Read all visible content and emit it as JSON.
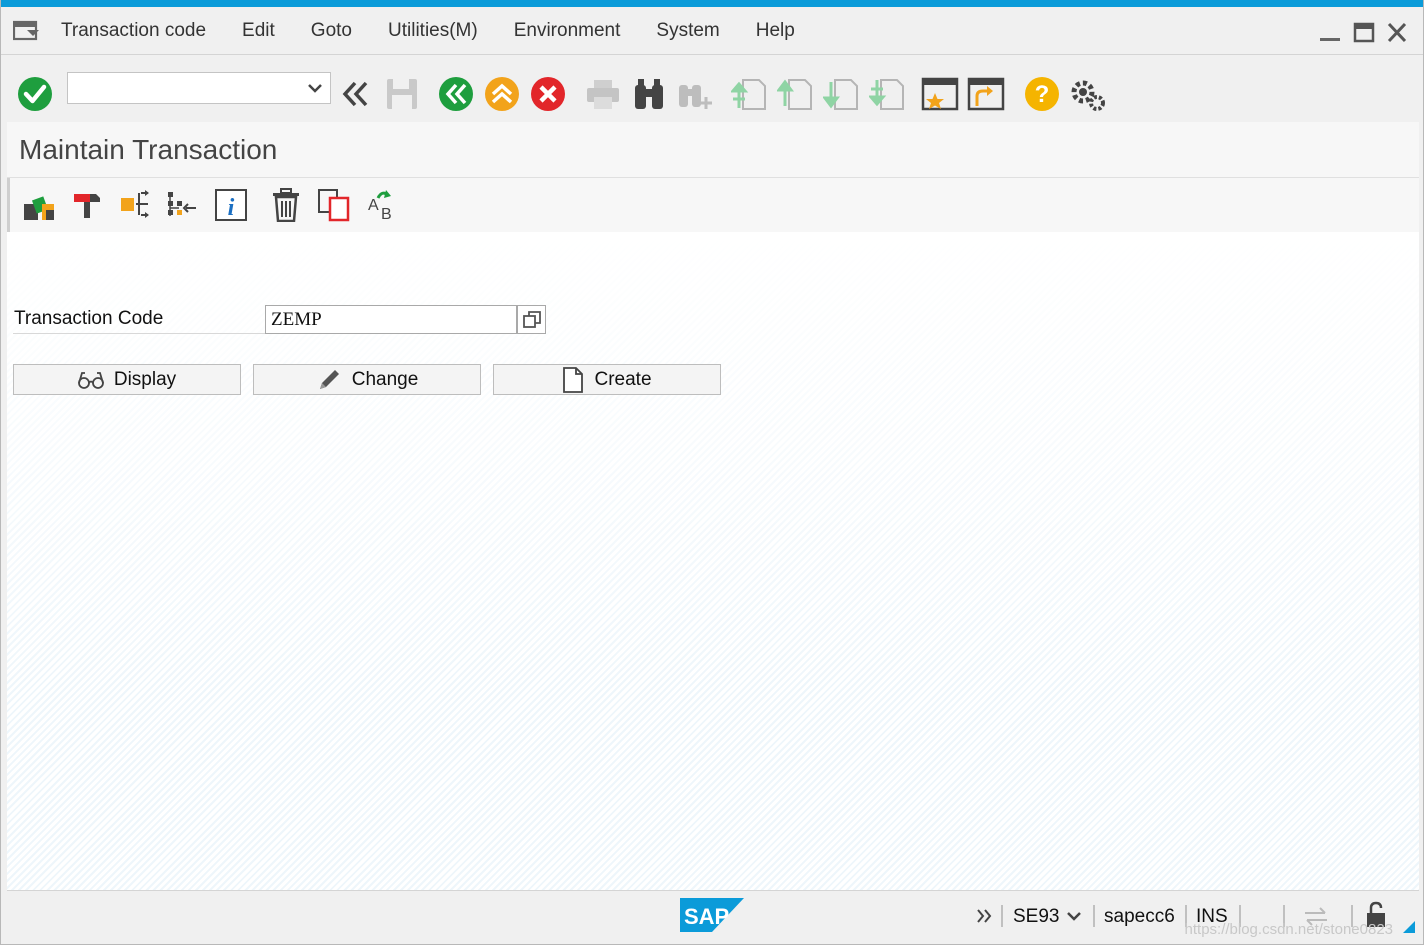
{
  "menubar": {
    "items": [
      "Transaction code",
      "Edit",
      "Goto",
      "Utilities(M)",
      "Environment",
      "System",
      "Help"
    ]
  },
  "toolbar": {
    "command_field_value": "",
    "icons": [
      "enter-icon",
      "back-double-icon",
      "save-icon",
      "back-icon",
      "exit-icon",
      "cancel-icon",
      "print-icon",
      "find-icon",
      "find-next-icon",
      "first-page-icon",
      "previous-page-icon",
      "next-page-icon",
      "last-page-icon",
      "create-session-icon",
      "generate-shortcut-icon",
      "help-icon",
      "customize-layout-icon"
    ]
  },
  "page": {
    "title": "Maintain Transaction"
  },
  "form": {
    "transaction_code_label": "Transaction Code",
    "transaction_code_value": "ZEMP"
  },
  "buttons": {
    "display": "Display",
    "change": "Change",
    "create": "Create"
  },
  "status": {
    "logo": "SAP",
    "transaction": "SE93",
    "system": "sapecc6",
    "mode": "INS"
  },
  "watermark": "https://blog.csdn.net/stone0823",
  "colors": {
    "accent": "#0b9bd9",
    "enter_green": "#1e9e3e",
    "exit_orange": "#f2a31b",
    "cancel_red": "#e2262a",
    "help_yellow": "#f5b400"
  }
}
